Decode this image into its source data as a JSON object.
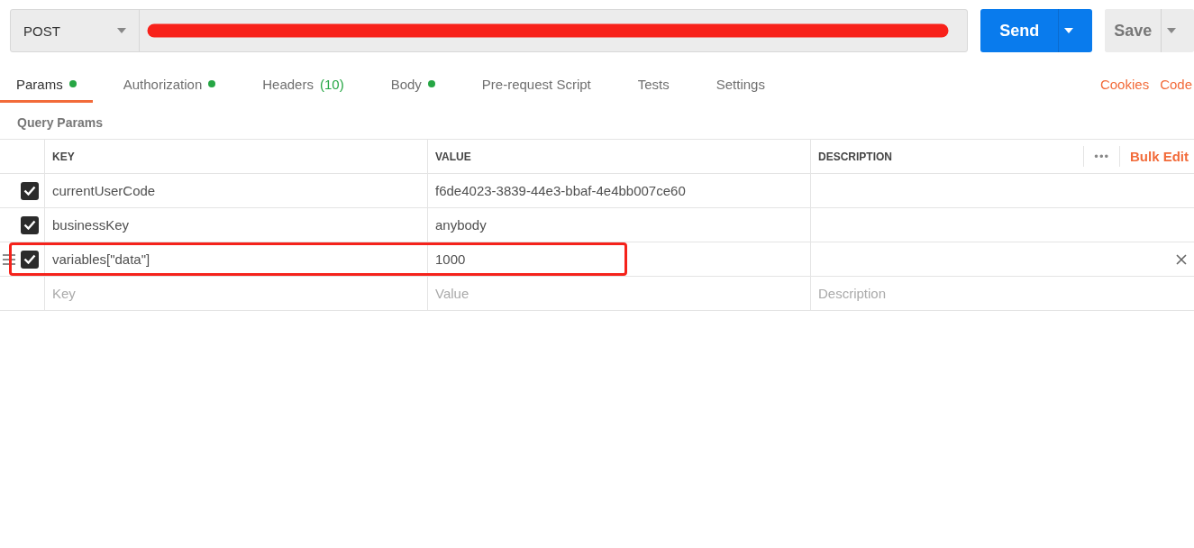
{
  "request": {
    "method": "POST",
    "url_redacted": true,
    "send_label": "Send",
    "save_label": "Save"
  },
  "tabs": [
    {
      "label": "Params",
      "selected": true,
      "dot": true
    },
    {
      "label": "Authorization",
      "selected": false,
      "dot": true
    },
    {
      "label": "Headers",
      "count": "(10)",
      "selected": false,
      "dot": false
    },
    {
      "label": "Body",
      "selected": false,
      "dot": true
    },
    {
      "label": "Pre-request Script",
      "selected": false,
      "dot": false
    },
    {
      "label": "Tests",
      "selected": false,
      "dot": false
    },
    {
      "label": "Settings",
      "selected": false,
      "dot": false
    }
  ],
  "links": [
    "Cookies",
    "Code"
  ],
  "section_title": "Query Params",
  "table": {
    "columns": [
      "KEY",
      "VALUE",
      "DESCRIPTION"
    ],
    "more": "•••",
    "bulk_edit": "Bulk Edit",
    "rows": [
      {
        "checked": true,
        "key": "currentUserCode",
        "value": "f6de4023-3839-44e3-bbaf-4e4bb007ce60",
        "hovered": false,
        "highlighted": false
      },
      {
        "checked": true,
        "key": "businessKey",
        "value": "anybody",
        "hovered": false,
        "highlighted": false
      },
      {
        "checked": true,
        "key": "variables[\"data\"]",
        "value": "1000",
        "hovered": true,
        "highlighted": true
      }
    ],
    "placeholders": {
      "key": "Key",
      "value": "Value",
      "description": "Description"
    }
  }
}
